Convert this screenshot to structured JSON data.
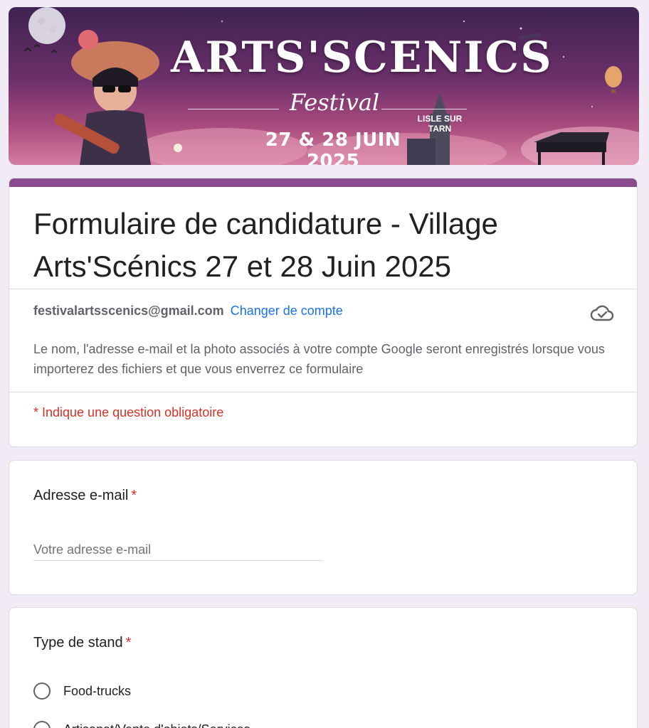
{
  "banner": {
    "title": "ARTS'SCENICS",
    "subtitle": "Festival",
    "location": "LISLE SUR TARN",
    "dates": "27 & 28 JUIN 2025"
  },
  "form": {
    "title": "Formulaire de candidature - Village Arts'Scénics 27 et 28 Juin 2025",
    "account_email": "festivalartsscenics@gmail.com",
    "switch_account_label": "Changer de compte",
    "account_notice": "Le nom, l'adresse e-mail et la photo associés à votre compte Google seront enregistrés lorsque vous importerez des fichiers et que vous enverrez ce formulaire",
    "required_note": "* Indique une question obligatoire"
  },
  "questions": {
    "email": {
      "label": "Adresse e-mail",
      "required_marker": "*",
      "placeholder": "Votre adresse e-mail"
    },
    "stand_type": {
      "label": "Type de stand",
      "required_marker": "*",
      "options": [
        {
          "label": "Food-trucks"
        },
        {
          "label": "Artisanat/Vente d'objets/Services"
        }
      ]
    }
  },
  "colors": {
    "accent": "#8a4b8f",
    "link": "#1a73e8",
    "required": "#d93025",
    "background": "#f0ebf5"
  },
  "icons": {
    "cloud": "cloud-check-icon"
  }
}
